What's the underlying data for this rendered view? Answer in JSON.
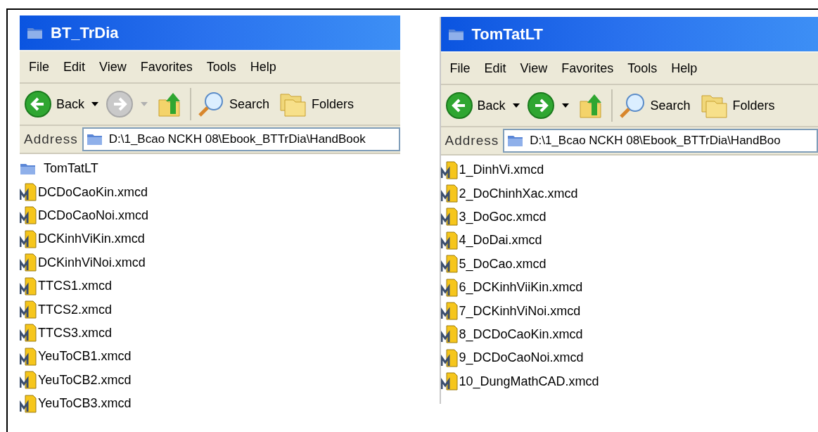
{
  "windows": [
    {
      "title": "BT_TrDia",
      "menu": [
        "File",
        "Edit",
        "View",
        "Favorites",
        "Tools",
        "Help"
      ],
      "toolbar": {
        "back": "Back",
        "forward_disabled": true,
        "search": "Search",
        "folders": "Folders"
      },
      "address_label": "Address",
      "address": "D:\\1_Bcao NCKH 08\\Ebook_BTTrDia\\HandBook",
      "files": [
        {
          "kind": "folder",
          "name": "TomTatLT"
        },
        {
          "kind": "mathcad",
          "name": "DCDoCaoKin.xmcd"
        },
        {
          "kind": "mathcad",
          "name": "DCDoCaoNoi.xmcd"
        },
        {
          "kind": "mathcad",
          "name": "DCKinhViKin.xmcd"
        },
        {
          "kind": "mathcad",
          "name": "DCKinhViNoi.xmcd"
        },
        {
          "kind": "mathcad",
          "name": "TTCS1.xmcd"
        },
        {
          "kind": "mathcad",
          "name": "TTCS2.xmcd"
        },
        {
          "kind": "mathcad",
          "name": "TTCS3.xmcd"
        },
        {
          "kind": "mathcad",
          "name": "YeuToCB1.xmcd"
        },
        {
          "kind": "mathcad",
          "name": "YeuToCB2.xmcd"
        },
        {
          "kind": "mathcad",
          "name": "YeuToCB3.xmcd"
        }
      ]
    },
    {
      "title": "TomTatLT",
      "menu": [
        "File",
        "Edit",
        "View",
        "Favorites",
        "Tools",
        "Help"
      ],
      "toolbar": {
        "back": "Back",
        "forward_disabled": false,
        "search": "Search",
        "folders": "Folders"
      },
      "address_label": "Address",
      "address": "D:\\1_Bcao NCKH 08\\Ebook_BTTrDia\\HandBoo",
      "files": [
        {
          "kind": "mathcad",
          "name": "1_DinhVi.xmcd"
        },
        {
          "kind": "mathcad",
          "name": "2_DoChinhXac.xmcd"
        },
        {
          "kind": "mathcad",
          "name": "3_DoGoc.xmcd"
        },
        {
          "kind": "mathcad",
          "name": "4_DoDai.xmcd"
        },
        {
          "kind": "mathcad",
          "name": "5_DoCao.xmcd"
        },
        {
          "kind": "mathcad",
          "name": "6_DCKinhViiKin.xmcd"
        },
        {
          "kind": "mathcad",
          "name": "7_DCKinhViNoi.xmcd"
        },
        {
          "kind": "mathcad",
          "name": "8_DCDoCaoKin.xmcd"
        },
        {
          "kind": "mathcad",
          "name": "9_DCDoCaoNoi.xmcd"
        },
        {
          "kind": "mathcad",
          "name": "10_DungMathCAD.xmcd"
        }
      ]
    }
  ]
}
